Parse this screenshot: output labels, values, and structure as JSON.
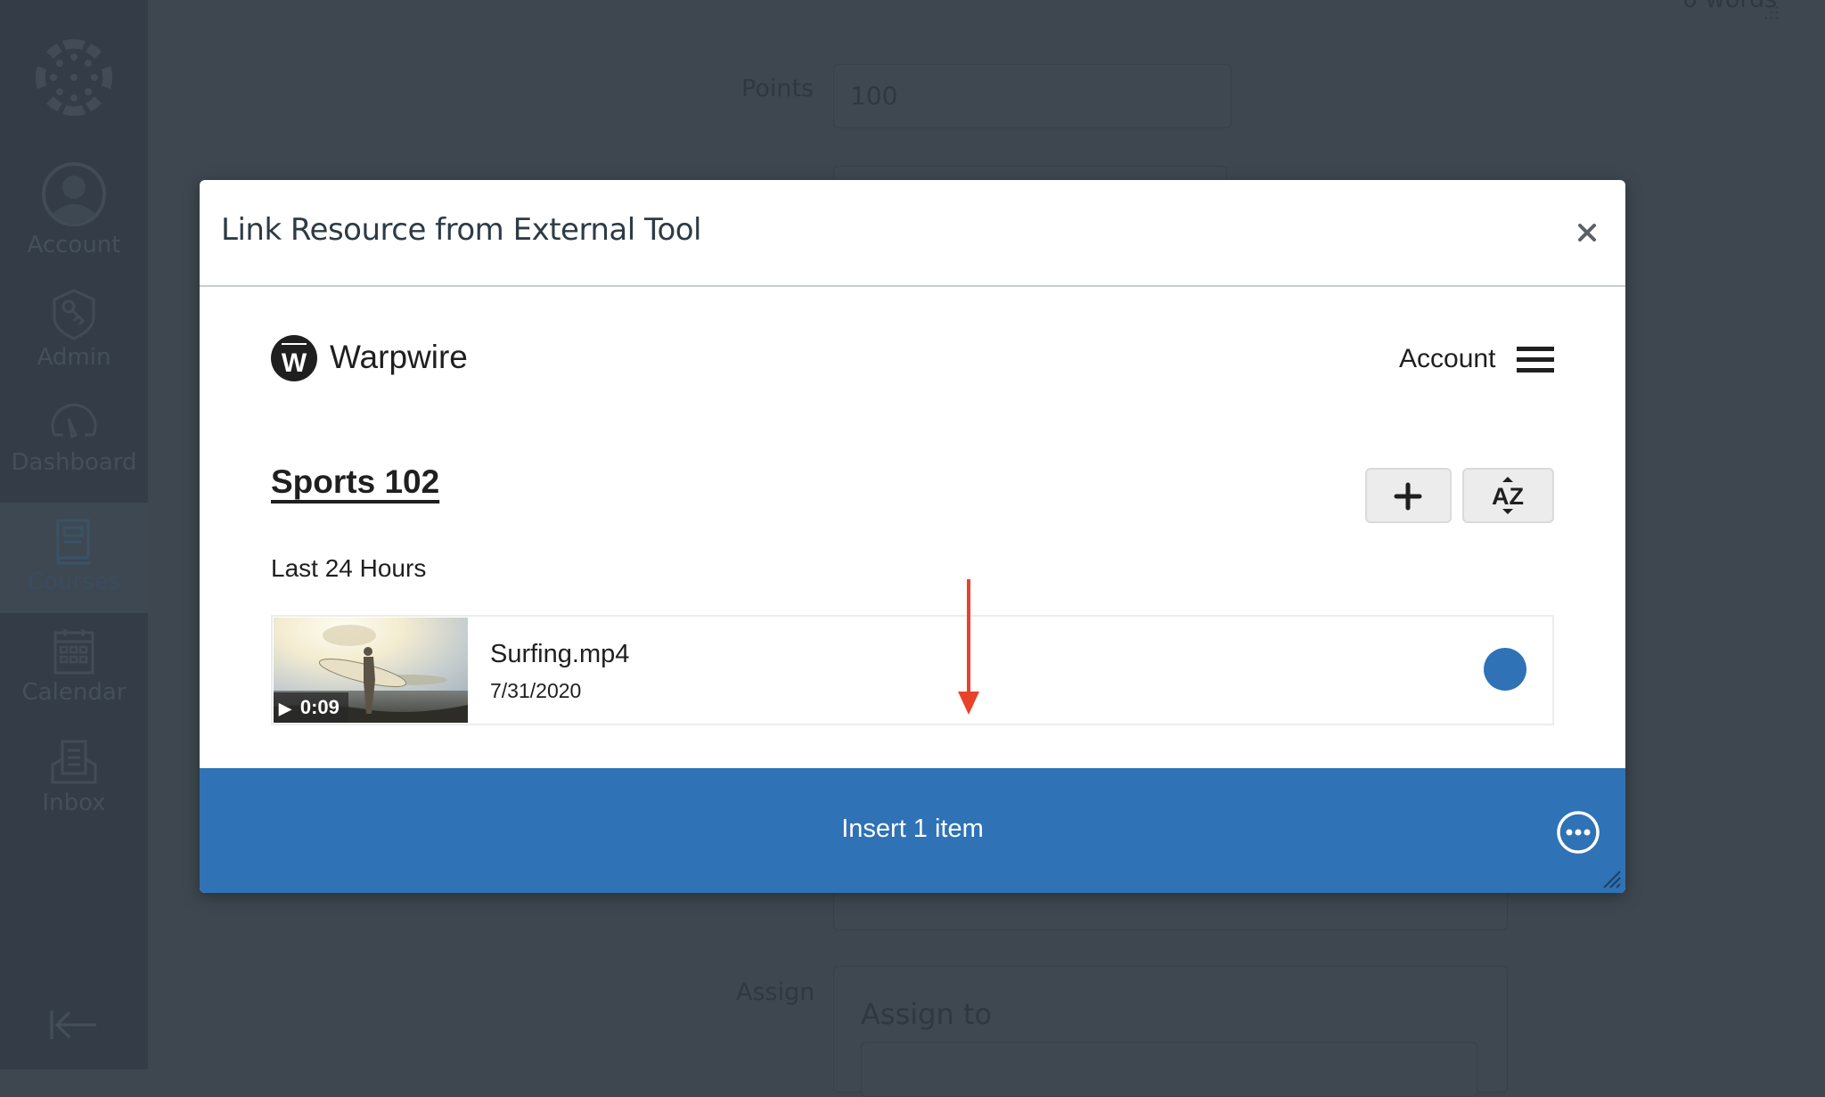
{
  "sidebar": {
    "logo": "canvas-logo-icon",
    "items": [
      {
        "label": "Account",
        "icon": "user-icon",
        "active": false
      },
      {
        "label": "Admin",
        "icon": "shield-key-icon",
        "active": false
      },
      {
        "label": "Dashboard",
        "icon": "gauge-icon",
        "active": false
      },
      {
        "label": "Courses",
        "icon": "book-icon",
        "active": true
      },
      {
        "label": "Calendar",
        "icon": "calendar-icon",
        "active": false
      },
      {
        "label": "Inbox",
        "icon": "inbox-icon",
        "active": false
      }
    ],
    "collapse_icon": "collapse-arrow-icon"
  },
  "background_form": {
    "top_right_text": "0 words",
    "points_label": "Points",
    "points_value": "100",
    "assign_label": "Assign",
    "assign_to_heading": "Assign to"
  },
  "modal": {
    "title": "Link Resource from External Tool",
    "close_icon": "close-icon",
    "tool": {
      "brand_name": "Warpwire",
      "brand_letter": "W",
      "account_label": "Account",
      "menu_icon": "hamburger-icon",
      "course_title": "Sports 102",
      "add_icon": "plus-icon",
      "sort_label": "AZ",
      "sort_icon": "sort-az-icon",
      "section_label": "Last 24 Hours",
      "items": [
        {
          "name": "Surfing.mp4",
          "date": "7/31/2020",
          "duration": "0:09",
          "play_glyph": "▶",
          "selected": true
        }
      ]
    },
    "footer": {
      "insert_label": "Insert 1 item",
      "more_icon": "more-options-icon",
      "resize_icon": "resize-handle-icon"
    }
  },
  "colors": {
    "primary_blue": "#2f72b5",
    "annotation_red": "#e8432a",
    "overlay": "#3e4750"
  }
}
